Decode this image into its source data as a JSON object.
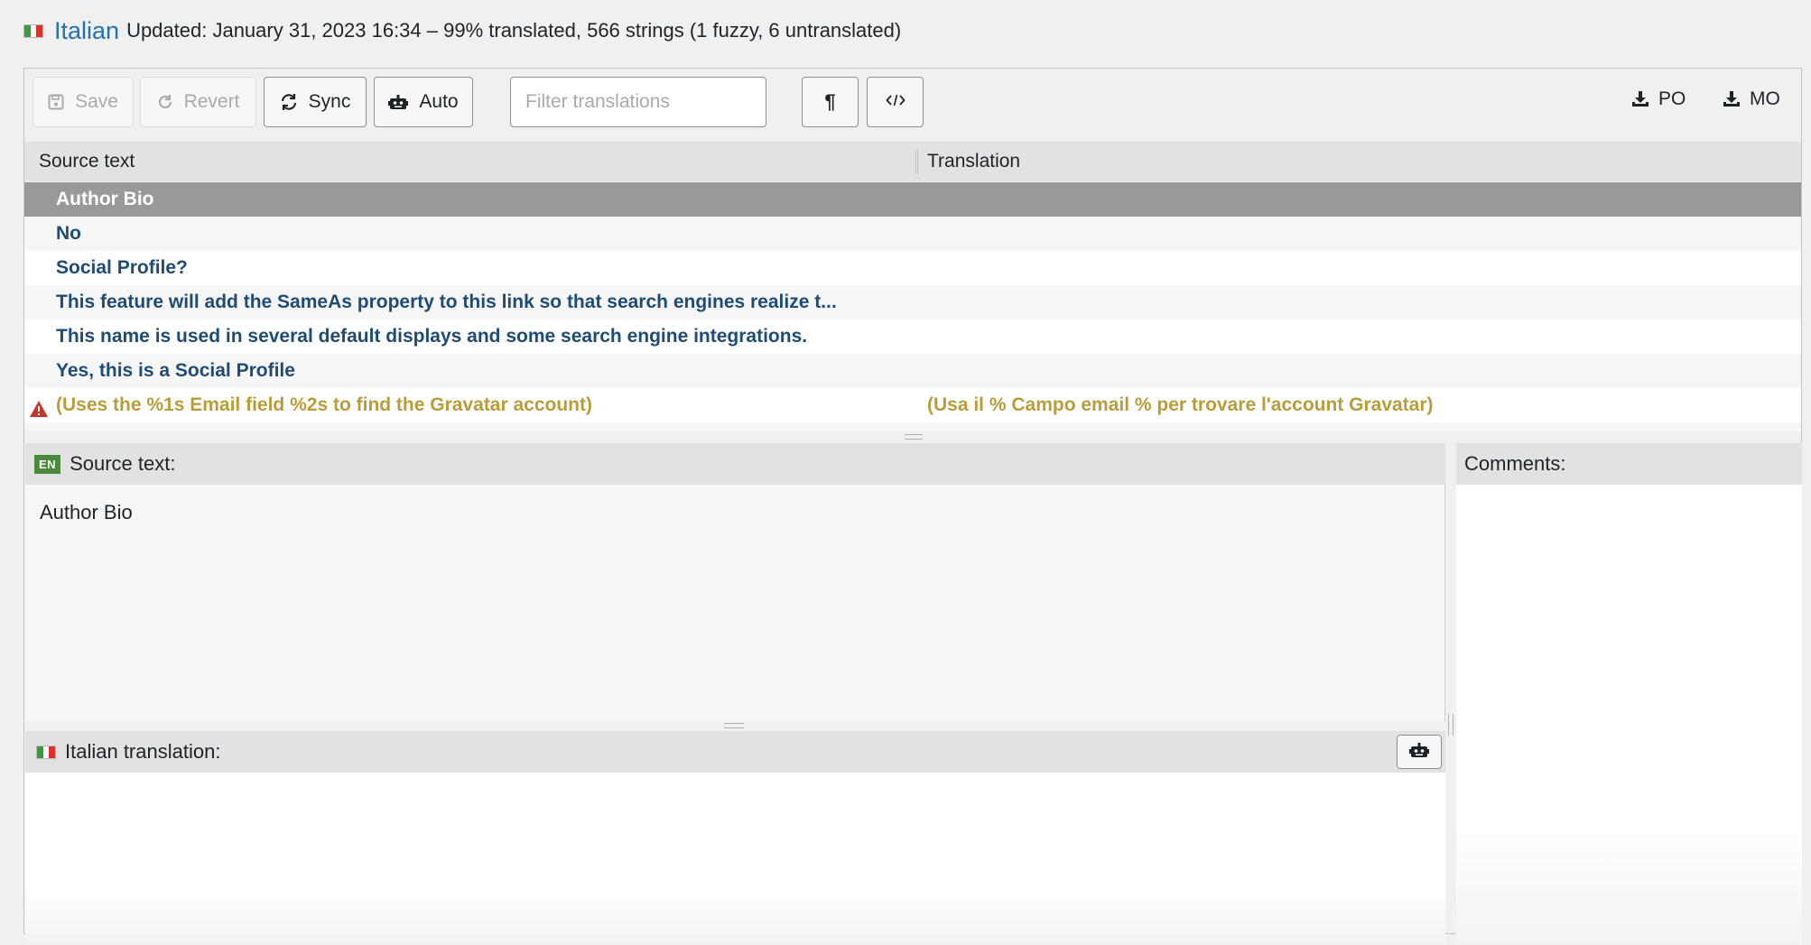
{
  "header": {
    "language": "Italian",
    "info": "Updated: January 31, 2023 16:34 – 99% translated, 566 strings (1 fuzzy, 6 untranslated)"
  },
  "toolbar": {
    "save": "Save",
    "revert": "Revert",
    "sync": "Sync",
    "auto": "Auto",
    "filter_placeholder": "Filter translations",
    "download_po": "PO",
    "download_mo": "MO"
  },
  "list": {
    "col_source": "Source text",
    "col_translation": "Translation",
    "rows": [
      {
        "source": "Author Bio",
        "translation": ""
      },
      {
        "source": "No",
        "translation": ""
      },
      {
        "source": "Social Profile?",
        "translation": ""
      },
      {
        "source": "This feature will add the SameAs property to this link so that search engines realize t...",
        "translation": ""
      },
      {
        "source": "This name is used in several default displays and some search engine integrations.",
        "translation": ""
      },
      {
        "source": "Yes, this is a Social Profile",
        "translation": ""
      },
      {
        "source": "(Uses the %1s Email field %2s to find the Gravatar account)",
        "translation": "(Usa il % Campo email % per trovare l'account Gravatar)"
      }
    ]
  },
  "source_panel": {
    "badge": "EN",
    "label": "Source text:",
    "text": "Author Bio"
  },
  "translation_panel": {
    "label": "Italian translation:"
  },
  "comments_panel": {
    "label": "Comments:"
  },
  "colors": {
    "link": "#2271b1",
    "row_text": "#1f4b77",
    "fuzzy": "#b89d3a",
    "selected_row": "#999999",
    "warning": "#c0392b"
  }
}
